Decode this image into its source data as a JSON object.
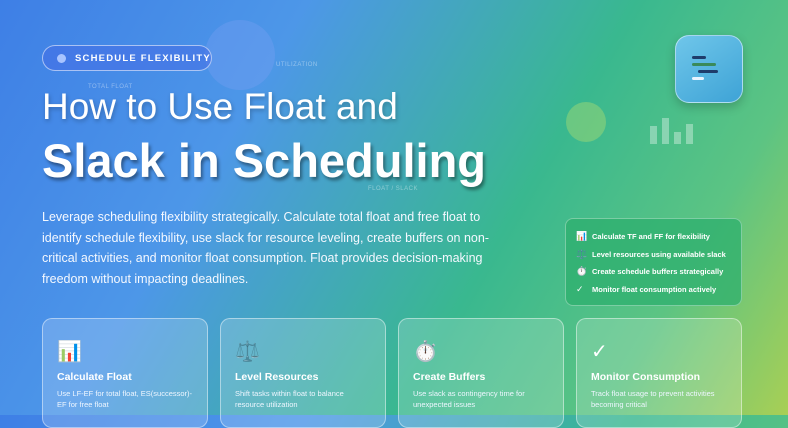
{
  "badge": "SCHEDULE FLEXIBILITY",
  "title_line1": "How to Use Float and",
  "title_line2": "Slack in Scheduling",
  "description": "Leverage scheduling flexibility strategically. Calculate total float and free float to identify schedule flexibility, use slack for resource leveling, create buffers on non-critical activities, and monitor float consumption. Float provides decision-making freedom without impacting deadlines.",
  "ghost_labels": [
    "TOTAL FLOAT",
    "UTILIZATION",
    "FLOAT / SLACK"
  ],
  "checklist": [
    {
      "icon": "📊",
      "icon_name": "chart-icon",
      "text": "Calculate TF and FF for flexibility"
    },
    {
      "icon": "⚖️",
      "icon_name": "scale-icon",
      "text": "Level resources using available slack"
    },
    {
      "icon": "⏱️",
      "icon_name": "stopwatch-icon",
      "text": "Create schedule buffers strategically"
    },
    {
      "icon": "✓",
      "icon_name": "checkmark-icon",
      "text": "Monitor float consumption actively"
    }
  ],
  "cards": [
    {
      "icon": "📊",
      "icon_name": "chart-icon",
      "title": "Calculate Float",
      "desc": "Use LF-EF for total float, ES(successor)-EF for free float"
    },
    {
      "icon": "⚖️",
      "icon_name": "scale-icon",
      "title": "Level Resources",
      "desc": "Shift tasks within float to balance resource utilization"
    },
    {
      "icon": "⏱️",
      "icon_name": "stopwatch-icon",
      "title": "Create Buffers",
      "desc": "Use slack as contingency time for unexpected issues"
    },
    {
      "icon": "✓",
      "icon_name": "checkmark-icon",
      "title": "Monitor Consumption",
      "desc": "Track float usage to prevent activities becoming critical"
    }
  ]
}
